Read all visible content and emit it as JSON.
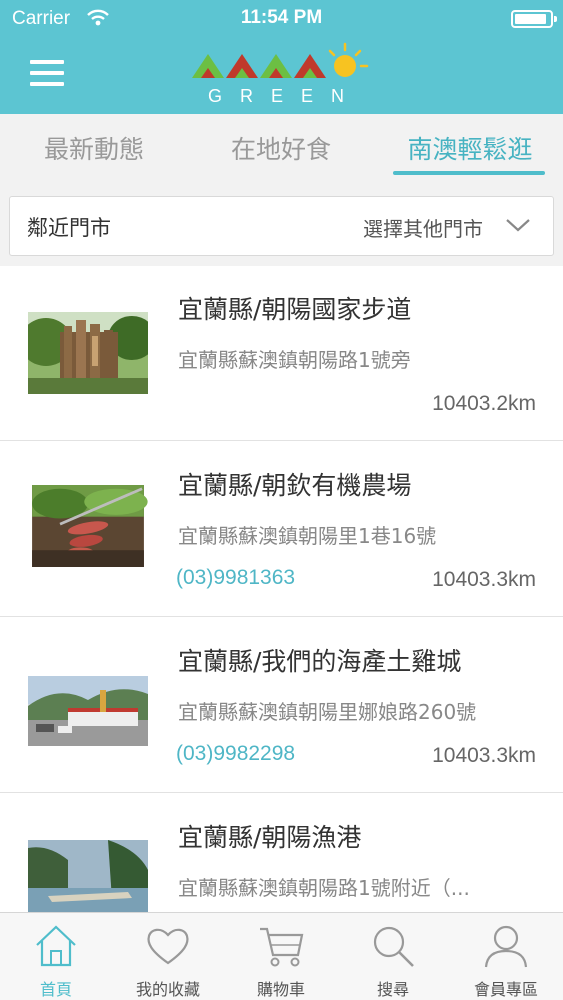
{
  "status_bar": {
    "carrier": "Carrier",
    "time": "11:54 PM",
    "battery_level": 0.9
  },
  "header": {
    "logo_text": "GREEN",
    "icons": [
      "menu-icon",
      "wifi-icon",
      "battery-icon",
      "sun-icon"
    ]
  },
  "tabs": [
    {
      "label": "最新動態",
      "active": false
    },
    {
      "label": "在地好食",
      "active": false
    },
    {
      "label": "南澳輕鬆逛",
      "active": true
    }
  ],
  "store_selector": {
    "label": "鄰近門市",
    "other_label": "選擇其他門市"
  },
  "list": [
    {
      "title": "宜蘭縣/朝陽國家步道",
      "address": "宜蘭縣蘇澳鎮朝陽路1號旁",
      "phone": "",
      "distance": "10403.2km"
    },
    {
      "title": "宜蘭縣/朝欽有機農場",
      "address": "宜蘭縣蘇澳鎮朝陽里1巷16號",
      "phone": "(03)9981363",
      "distance": "10403.3km"
    },
    {
      "title": "宜蘭縣/我們的海產土雞城",
      "address": "宜蘭縣蘇澳鎮朝陽里娜娘路260號",
      "phone": "(03)9982298",
      "distance": "10403.3km"
    },
    {
      "title": "宜蘭縣/朝陽漁港",
      "address": "宜蘭縣蘇澳鎮朝陽路1號附近（...",
      "phone": "",
      "distance": ""
    }
  ],
  "bottom_nav": [
    {
      "label": "首頁",
      "icon": "home-icon",
      "active": true
    },
    {
      "label": "我的收藏",
      "icon": "heart-icon",
      "active": false
    },
    {
      "label": "購物車",
      "icon": "cart-icon",
      "active": false
    },
    {
      "label": "搜尋",
      "icon": "search-icon",
      "active": false
    },
    {
      "label": "會員專區",
      "icon": "user-icon",
      "active": false
    }
  ],
  "colors": {
    "brand": "#5cc5d2",
    "accent": "#47b3c2",
    "logo_green": "#7bc143",
    "logo_red": "#c0392b",
    "sun": "#f7c321"
  }
}
